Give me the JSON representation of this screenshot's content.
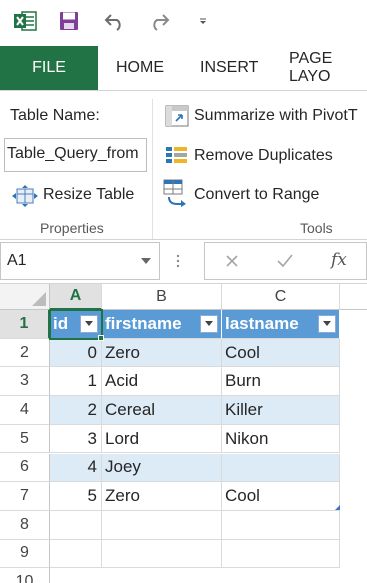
{
  "app": {
    "brand_color": "#217346",
    "excel_icon": "excel-logo-icon"
  },
  "qat": {
    "save_icon": "save-icon",
    "undo_icon": "undo-icon",
    "redo_icon": "redo-icon",
    "customize_icon": "customize-qat-icon"
  },
  "tabs": [
    {
      "label": "FILE",
      "active": true
    },
    {
      "label": "HOME"
    },
    {
      "label": "INSERT"
    },
    {
      "label": "PAGE LAYO"
    }
  ],
  "ribbon": {
    "properties": {
      "table_name_label": "Table Name:",
      "table_name_value": "Table_Query_from",
      "resize_label": "Resize Table",
      "group_label": "Properties"
    },
    "tools": {
      "summarize_label": "Summarize with PivotT",
      "remove_dup_label": "Remove Duplicates",
      "convert_label": "Convert to Range",
      "group_label": "Tools"
    }
  },
  "formula_bar": {
    "name_box": "A1",
    "cancel_icon": "cancel-icon",
    "enter_icon": "enter-check-icon",
    "fx_label": "fx",
    "formula": ""
  },
  "grid": {
    "columns": [
      "A",
      "B",
      "C"
    ],
    "active_column": "A",
    "active_row": "1",
    "row_numbers": [
      "1",
      "2",
      "3",
      "4",
      "5",
      "6",
      "7",
      "8",
      "9",
      "10"
    ],
    "table": {
      "header_color": "#5b9bd5",
      "band_color": "#ddebf7",
      "headers": [
        "id",
        "firstname",
        "lastname"
      ],
      "rows": [
        [
          "0",
          "Zero",
          "Cool"
        ],
        [
          "1",
          "Acid",
          "Burn"
        ],
        [
          "2",
          "Cereal",
          "Killer"
        ],
        [
          "3",
          "Lord",
          "Nikon"
        ],
        [
          "4",
          "Joey",
          ""
        ],
        [
          "5",
          "Zero",
          "Cool"
        ]
      ]
    }
  }
}
